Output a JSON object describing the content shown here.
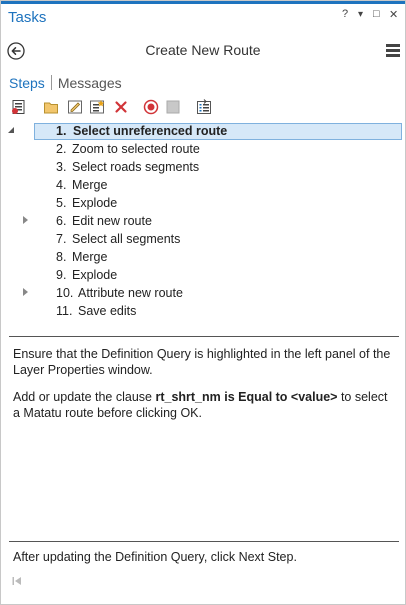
{
  "window": {
    "title": "Tasks",
    "help_label": "?",
    "dropdown_label": "▾",
    "restore_label": "□",
    "close_label": "✕"
  },
  "header": {
    "title": "Create New Route"
  },
  "tabs": [
    {
      "label": "Steps",
      "active": true
    },
    {
      "label": "Messages",
      "active": false
    }
  ],
  "toolbar": {
    "icons": [
      "task-properties-icon",
      "open-folder-icon",
      "edit-step-icon",
      "insert-step-icon",
      "delete-icon",
      "record-icon",
      "stop-icon",
      "step-list-icon"
    ]
  },
  "steps": [
    {
      "num": "1.",
      "label": "Select unreferenced route",
      "selected": true,
      "expandable": false
    },
    {
      "num": "2.",
      "label": "Zoom to selected route",
      "selected": false,
      "expandable": false
    },
    {
      "num": "3.",
      "label": "Select roads segments",
      "selected": false,
      "expandable": false
    },
    {
      "num": "4.",
      "label": "Merge",
      "selected": false,
      "expandable": false
    },
    {
      "num": "5.",
      "label": "Explode",
      "selected": false,
      "expandable": false
    },
    {
      "num": "6.",
      "label": "Edit new route",
      "selected": false,
      "expandable": true
    },
    {
      "num": "7.",
      "label": "Select all segments",
      "selected": false,
      "expandable": false
    },
    {
      "num": "8.",
      "label": "Merge",
      "selected": false,
      "expandable": false
    },
    {
      "num": "9.",
      "label": "Explode",
      "selected": false,
      "expandable": false
    },
    {
      "num": "10.",
      "label": "Attribute new route",
      "selected": false,
      "expandable": true
    },
    {
      "num": "11.",
      "label": "Save edits",
      "selected": false,
      "expandable": false
    }
  ],
  "instructions": {
    "para1": "Ensure that the Definition Query is highlighted in the left panel of the Layer Properties window.",
    "para2_prefix": "Add or update the clause ",
    "para2_bold": "rt_shrt_nm is Equal to <value>",
    "para2_suffix": " to select a Matatu route before clicking OK."
  },
  "footer": {
    "text": "After updating the Definition Query, click Next Step."
  },
  "colors": {
    "accent": "#1e73be",
    "selection_bg": "#d6e8f8",
    "selection_border": "#7fb1de",
    "delete_red": "#d13438",
    "record_red": "#d13438"
  }
}
